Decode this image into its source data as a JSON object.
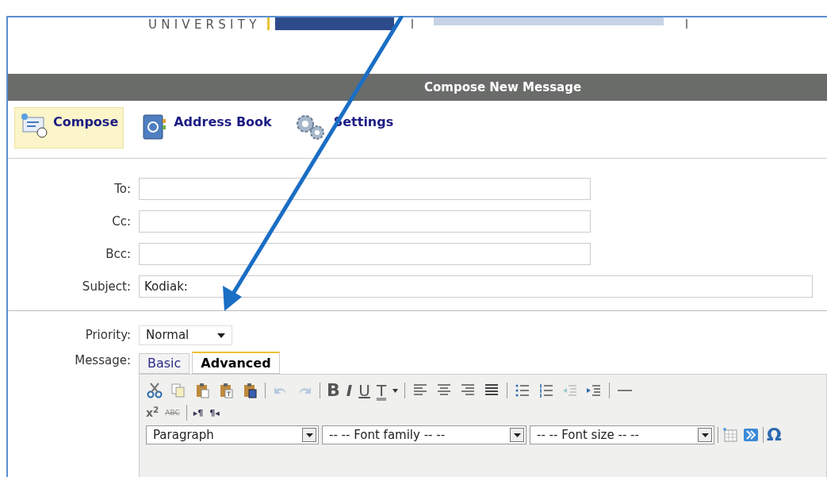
{
  "header": {
    "logo_text": "UNIVERSITY"
  },
  "title_bar": {
    "title": "Compose New Message"
  },
  "nav": [
    {
      "label": "Compose",
      "selected": true
    },
    {
      "label": "Address Book",
      "selected": false
    },
    {
      "label": "Settings",
      "selected": false
    }
  ],
  "address_fields": [
    {
      "label": "To:"
    },
    {
      "label": "Cc:"
    },
    {
      "label": "Bcc:"
    },
    {
      "label": "Subject:",
      "value": "Kodiak:"
    }
  ],
  "priority": {
    "label": "Priority:",
    "value": "Normal"
  },
  "message": {
    "label": "Message:",
    "tabs": [
      {
        "label": "Basic",
        "selected": false
      },
      {
        "label": "Advanced",
        "selected": true
      }
    ]
  },
  "editor_toolbar": {
    "glyphs_row_1": [
      "B",
      "I",
      "U",
      "T"
    ],
    "glyphs_row_2": [
      "x$^{2}$",
      "ABC",
      "▸¶",
      "¶◂"
    ],
    "selects": [
      "Paragraph",
      "-- -- Font family -- --",
      "-- -- Font size -- --"
    ],
    "glyphs_row_3": [
      "Ω"
    ]
  }
}
